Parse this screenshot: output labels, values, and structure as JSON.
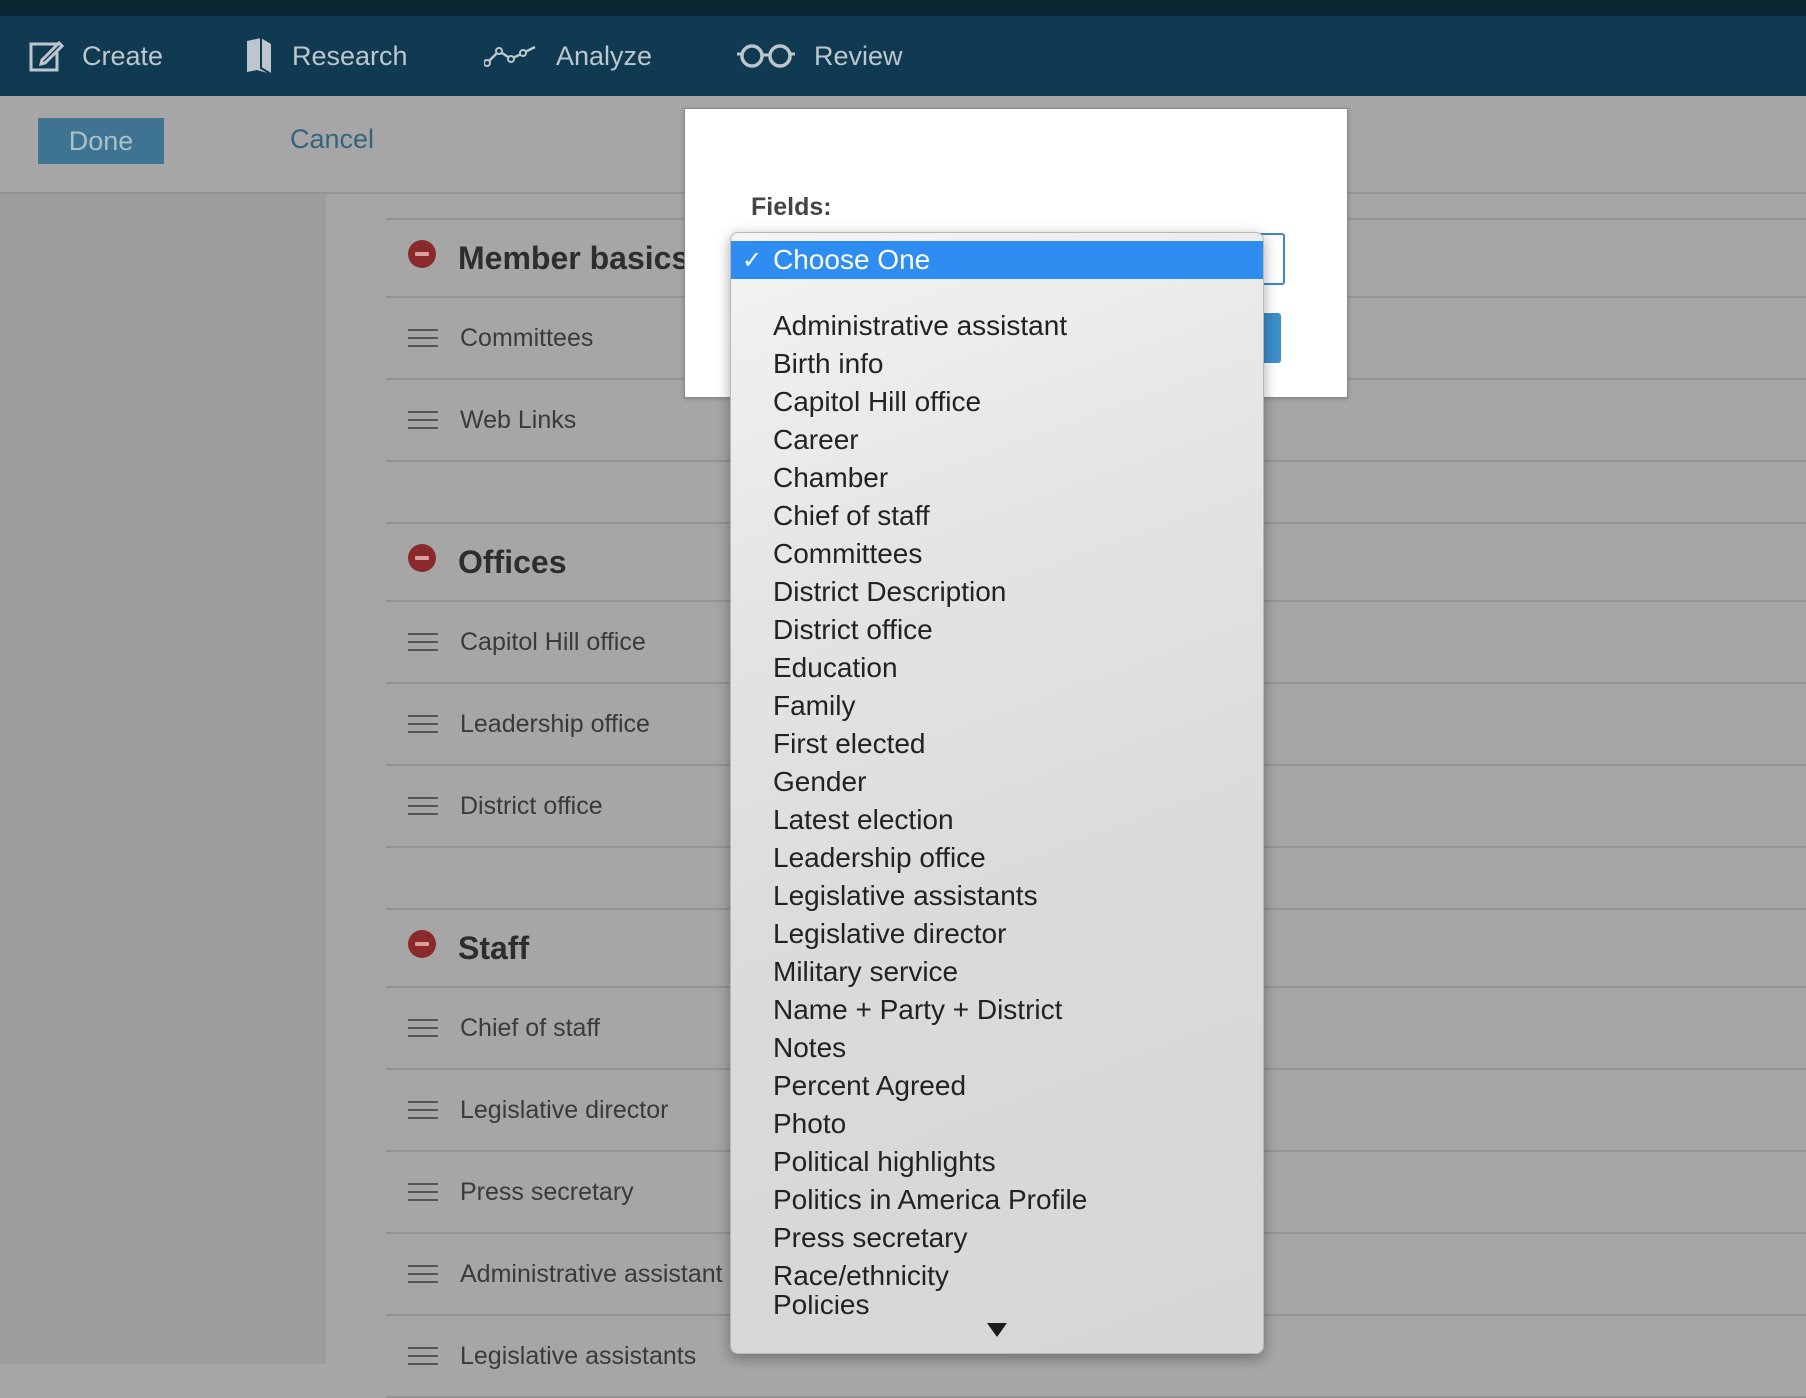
{
  "nav": {
    "items": [
      {
        "label": "Create",
        "icon": "edit-icon"
      },
      {
        "label": "Research",
        "icon": "book-icon"
      },
      {
        "label": "Analyze",
        "icon": "line-chart-icon"
      },
      {
        "label": "Review",
        "icon": "glasses-icon"
      }
    ]
  },
  "toolbar": {
    "done_label": "Done",
    "cancel_label": "Cancel"
  },
  "sections": [
    {
      "title": "Member basics",
      "rows": [
        "Committees",
        "Web Links"
      ]
    },
    {
      "title": "Offices",
      "rows": [
        "Capitol Hill office",
        "Leadership office",
        "District office"
      ]
    },
    {
      "title": "Staff",
      "rows": [
        "Chief of staff",
        "Legislative director",
        "Press secretary",
        "Administrative assistant",
        "Legislative assistants"
      ]
    }
  ],
  "modal": {
    "fields_label": "Fields:"
  },
  "dropdown": {
    "selected": "Choose One",
    "check": "✓",
    "options": [
      "Administrative assistant",
      "Birth info",
      "Capitol Hill office",
      "Career",
      "Chamber",
      "Chief of staff",
      "Committees",
      "District Description",
      "District office",
      "Education",
      "Family",
      "First elected",
      "Gender",
      "Latest election",
      "Leadership office",
      "Legislative assistants",
      "Legislative director",
      "Military service",
      "Name + Party + District",
      "Notes",
      "Percent Agreed",
      "Photo",
      "Political highlights",
      "Politics in America Profile",
      "Press secretary",
      "Race/ethnicity",
      "Policies"
    ]
  },
  "colors": {
    "nav_bg": "#0f3a51",
    "accent": "#2f8df2",
    "remove": "#8a2a2a"
  }
}
